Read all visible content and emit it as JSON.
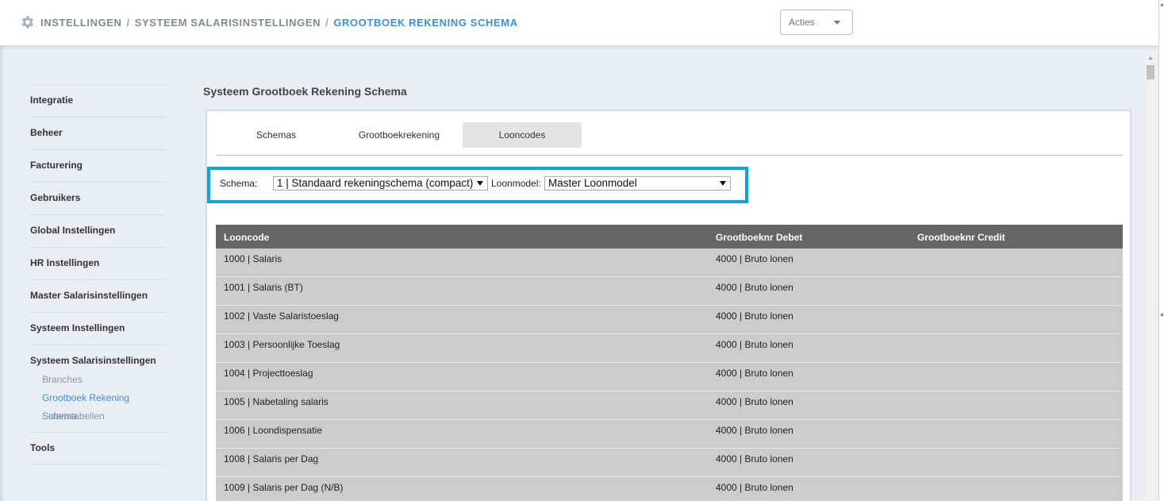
{
  "breadcrumb": {
    "items": [
      "INSTELLINGEN",
      "SYSTEEM SALARISINSTELLINGEN",
      "GROOTBOEK REKENING SCHEMA"
    ],
    "separator": "/"
  },
  "actions": {
    "label": "Acties"
  },
  "sidebar": {
    "items": [
      {
        "label": "Integratie"
      },
      {
        "label": "Beheer"
      },
      {
        "label": "Facturering"
      },
      {
        "label": "Gebruikers"
      },
      {
        "label": "Global Instellingen"
      },
      {
        "label": "HR Instellingen"
      },
      {
        "label": "Master Salarisinstellingen"
      },
      {
        "label": "Systeem Instellingen"
      },
      {
        "label": "Systeem Salarisinstellingen",
        "children": [
          "Branches",
          "Grootboek Rekening Schema",
          "Salaristabellen"
        ]
      },
      {
        "label": "Tools"
      }
    ],
    "active_child": "Grootboek Rekening Schema"
  },
  "page": {
    "title": "Systeem Grootboek Rekening Schema"
  },
  "tabs": [
    {
      "label": "Schemas",
      "active": false
    },
    {
      "label": "Grootboekrekening",
      "active": false
    },
    {
      "label": "Looncodes",
      "active": true
    }
  ],
  "filters": {
    "schema_label": "Schema:",
    "schema_value": "1 | Standaard rekeningschema (compact)",
    "loonmodel_label": "Loonmodel:",
    "loonmodel_value": "Master Loonmodel",
    "highlight_color": "#0aa6e0"
  },
  "table": {
    "columns": [
      "Looncode",
      "Grootboeknr Debet",
      "Grootboeknr Credit"
    ],
    "rows": [
      [
        "1000 | Salaris",
        "4000 | Bruto lonen",
        ""
      ],
      [
        "1001 | Salaris (BT)",
        "4000 | Bruto lonen",
        ""
      ],
      [
        "1002 | Vaste Salaristoeslag",
        "4000 | Bruto lonen",
        ""
      ],
      [
        "1003 | Persoonlijke Toeslag",
        "4000 | Bruto lonen",
        ""
      ],
      [
        "1004 | Projecttoeslag",
        "4000 | Bruto lonen",
        ""
      ],
      [
        "1005 | Nabetaling salaris",
        "4000 | Bruto lonen",
        ""
      ],
      [
        "1006 | Loondispensatie",
        "4000 | Bruto lonen",
        ""
      ],
      [
        "1008 | Salaris per Dag",
        "4000 | Bruto lonen",
        ""
      ],
      [
        "1009 | Salaris per Dag (N/B)",
        "4000 | Bruto lonen",
        ""
      ]
    ]
  },
  "colors": {
    "accent": "#3f8ed4",
    "header_bg": "#666666",
    "row_bg": "#cccccc"
  }
}
